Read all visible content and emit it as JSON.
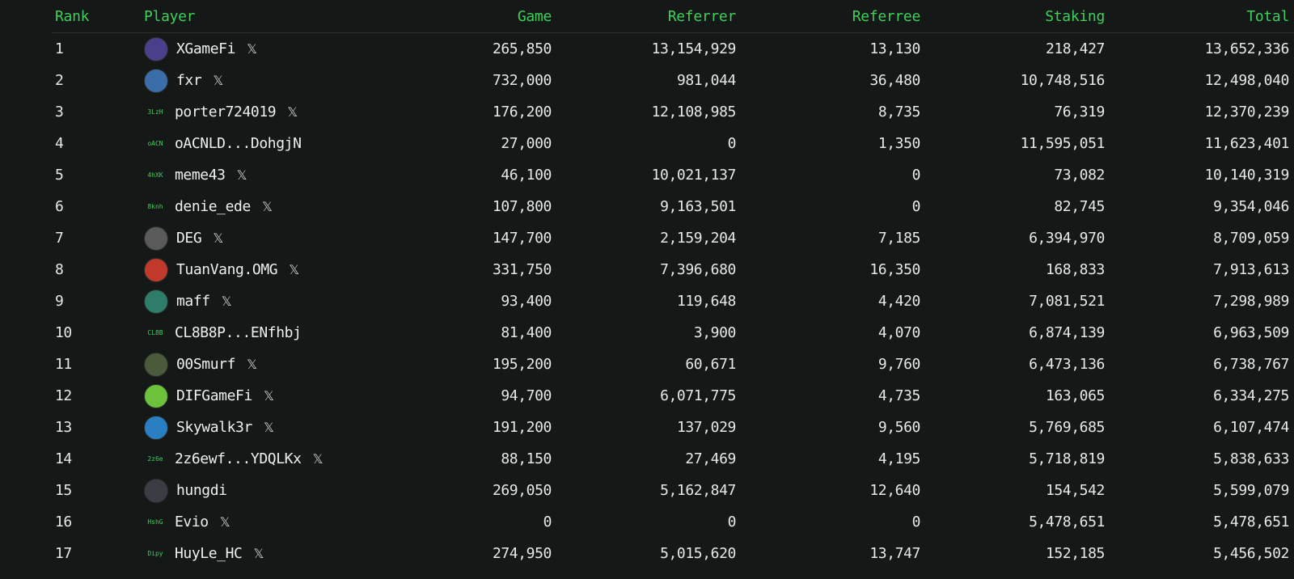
{
  "columns": [
    "Rank",
    "Player",
    "Game",
    "Referrer",
    "Referree",
    "Staking",
    "Total"
  ],
  "rows": [
    {
      "rank": "1",
      "player": "XGameFi",
      "avatar_text": "",
      "avatar_color": "#4a3f8a",
      "x": true,
      "game": "265,850",
      "referrer": "13,154,929",
      "referree": "13,130",
      "staking": "218,427",
      "total": "13,652,336"
    },
    {
      "rank": "2",
      "player": "fxr",
      "avatar_text": "",
      "avatar_color": "#3b6ea8",
      "x": true,
      "game": "732,000",
      "referrer": "981,044",
      "referree": "36,480",
      "staking": "10,748,516",
      "total": "12,498,040"
    },
    {
      "rank": "3",
      "player": "porter724019",
      "avatar_text": "3LzH",
      "avatar_color": "",
      "x": true,
      "game": "176,200",
      "referrer": "12,108,985",
      "referree": "8,735",
      "staking": "76,319",
      "total": "12,370,239"
    },
    {
      "rank": "4",
      "player": "oACNLD...DohgjN",
      "avatar_text": "oACN",
      "avatar_color": "",
      "x": false,
      "game": "27,000",
      "referrer": "0",
      "referree": "1,350",
      "staking": "11,595,051",
      "total": "11,623,401"
    },
    {
      "rank": "5",
      "player": "meme43",
      "avatar_text": "4hXK",
      "avatar_color": "",
      "x": true,
      "game": "46,100",
      "referrer": "10,021,137",
      "referree": "0",
      "staking": "73,082",
      "total": "10,140,319"
    },
    {
      "rank": "6",
      "player": "denie_ede",
      "avatar_text": "8knh",
      "avatar_color": "",
      "x": true,
      "game": "107,800",
      "referrer": "9,163,501",
      "referree": "0",
      "staking": "82,745",
      "total": "9,354,046"
    },
    {
      "rank": "7",
      "player": "DEG",
      "avatar_text": "",
      "avatar_color": "#5a5a5a",
      "x": true,
      "game": "147,700",
      "referrer": "2,159,204",
      "referree": "7,185",
      "staking": "6,394,970",
      "total": "8,709,059"
    },
    {
      "rank": "8",
      "player": "TuanVang.OMG",
      "avatar_text": "",
      "avatar_color": "#c0392b",
      "x": true,
      "game": "331,750",
      "referrer": "7,396,680",
      "referree": "16,350",
      "staking": "168,833",
      "total": "7,913,613"
    },
    {
      "rank": "9",
      "player": "maff",
      "avatar_text": "",
      "avatar_color": "#2e7d6b",
      "x": true,
      "game": "93,400",
      "referrer": "119,648",
      "referree": "4,420",
      "staking": "7,081,521",
      "total": "7,298,989"
    },
    {
      "rank": "10",
      "player": "CL8B8P...ENfhbj",
      "avatar_text": "CL8B",
      "avatar_color": "",
      "x": false,
      "game": "81,400",
      "referrer": "3,900",
      "referree": "4,070",
      "staking": "6,874,139",
      "total": "6,963,509"
    },
    {
      "rank": "11",
      "player": "00Smurf",
      "avatar_text": "",
      "avatar_color": "#4b5a3a",
      "x": true,
      "game": "195,200",
      "referrer": "60,671",
      "referree": "9,760",
      "staking": "6,473,136",
      "total": "6,738,767"
    },
    {
      "rank": "12",
      "player": "DIFGameFi",
      "avatar_text": "",
      "avatar_color": "#6cc23a",
      "x": true,
      "game": "94,700",
      "referrer": "6,071,775",
      "referree": "4,735",
      "staking": "163,065",
      "total": "6,334,275"
    },
    {
      "rank": "13",
      "player": "Skywalk3r",
      "avatar_text": "",
      "avatar_color": "#2a7fc2",
      "x": true,
      "game": "191,200",
      "referrer": "137,029",
      "referree": "9,560",
      "staking": "5,769,685",
      "total": "6,107,474"
    },
    {
      "rank": "14",
      "player": "2z6ewf...YDQLKx",
      "avatar_text": "2z6e",
      "avatar_color": "",
      "x": true,
      "game": "88,150",
      "referrer": "27,469",
      "referree": "4,195",
      "staking": "5,718,819",
      "total": "5,838,633"
    },
    {
      "rank": "15",
      "player": "hungdi",
      "avatar_text": "",
      "avatar_color": "#3a3e44",
      "x": false,
      "game": "269,050",
      "referrer": "5,162,847",
      "referree": "12,640",
      "staking": "154,542",
      "total": "5,599,079"
    },
    {
      "rank": "16",
      "player": "Evio",
      "avatar_text": "HshG",
      "avatar_color": "",
      "x": true,
      "game": "0",
      "referrer": "0",
      "referree": "0",
      "staking": "5,478,651",
      "total": "5,478,651"
    },
    {
      "rank": "17",
      "player": "HuyLe_HC",
      "avatar_text": "Dipy",
      "avatar_color": "",
      "x": true,
      "game": "274,950",
      "referrer": "5,015,620",
      "referree": "13,747",
      "staking": "152,185",
      "total": "5,456,502"
    }
  ],
  "x_icon_glyph": "𝕏",
  "colors": {
    "background": "#141816",
    "header": "#3fcf5c",
    "text": "#e6e9e7"
  }
}
